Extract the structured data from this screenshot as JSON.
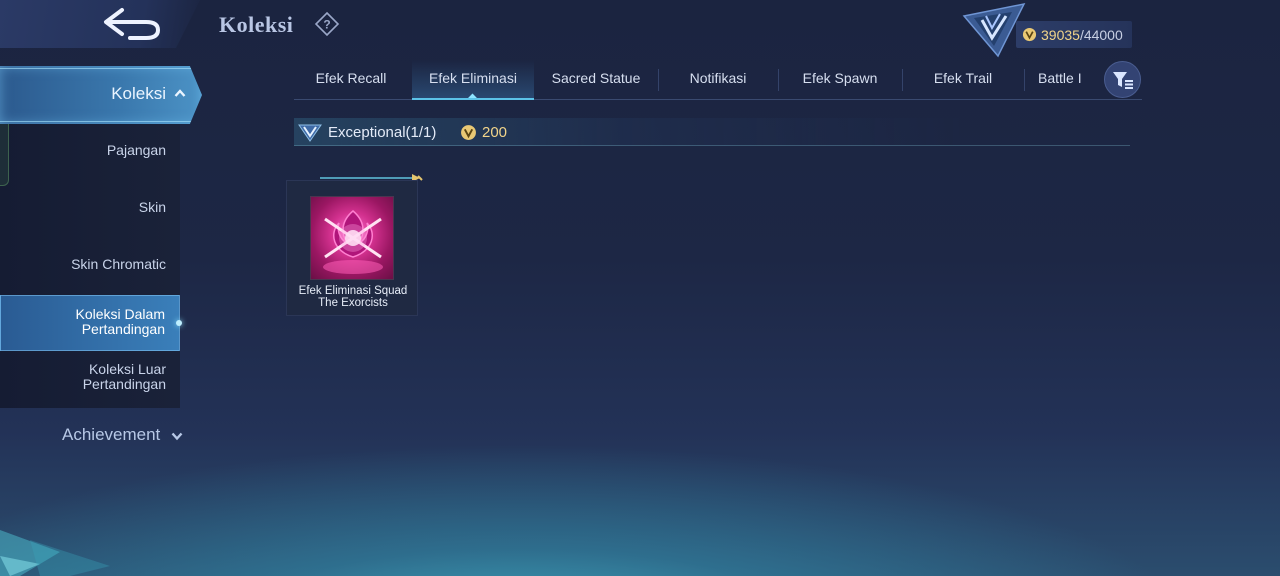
{
  "header": {
    "title": "Koleksi",
    "points_current": "39035",
    "points_separator": "/",
    "points_max": "44000"
  },
  "sidebar": {
    "top": {
      "label": "Koleksi"
    },
    "items": [
      {
        "label": "Pajangan"
      },
      {
        "label": "Skin"
      },
      {
        "label": "Skin Chromatic"
      },
      {
        "label": "Koleksi Dalam Pertandingan",
        "line1": "Koleksi Dalam",
        "line2": "Pertandingan",
        "active": true
      },
      {
        "label": "Koleksi Luar Pertandingan",
        "line1": "Koleksi Luar",
        "line2": "Pertandingan"
      }
    ],
    "bottom": {
      "label": "Achievement"
    }
  },
  "tabs": [
    {
      "label": "Efek Recall"
    },
    {
      "label": "Efek Eliminasi",
      "active": true
    },
    {
      "label": "Sacred Statue"
    },
    {
      "label": "Notifikasi"
    },
    {
      "label": "Efek Spawn"
    },
    {
      "label": "Efek Trail"
    },
    {
      "label": "Battle I"
    }
  ],
  "category": {
    "label": "Exceptional(1/1)",
    "price": "200"
  },
  "items": [
    {
      "name_line1": "Efek Eliminasi Squad",
      "name_line2": "The Exorcists"
    }
  ],
  "colors": {
    "accent_cyan": "#5cc3e8",
    "gold": "#f1d48a",
    "active_blue": "#3a7fba"
  },
  "icons": {
    "back": "back-arrow-icon",
    "help": "help-icon",
    "rank": "rank-emblem-icon",
    "coin": "coin-icon",
    "filter": "filter-icon"
  }
}
